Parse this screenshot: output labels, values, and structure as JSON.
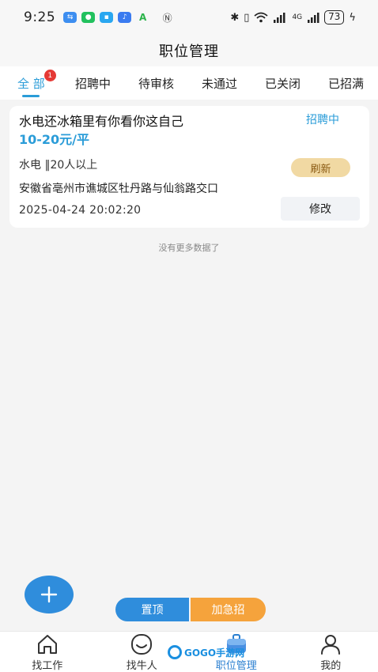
{
  "status_bar": {
    "time": "9:25",
    "battery": "73",
    "network": "4G"
  },
  "header": {
    "title": "职位管理"
  },
  "tabs": [
    {
      "label": "全 部",
      "badge": "1",
      "active": true
    },
    {
      "label": "招聘中"
    },
    {
      "label": "待审核"
    },
    {
      "label": "未通过"
    },
    {
      "label": "已关闭"
    },
    {
      "label": "已招满"
    }
  ],
  "job": {
    "title": "水电还冰箱里有你看你这自己",
    "status": "招聘中",
    "salary": "10-20元/平",
    "meta": "水电 ‖20人以上",
    "address": "安徽省亳州市谯城区牡丹路与仙翁路交口",
    "time": "2025-04-24 20:02:20",
    "refresh_label": "刷新",
    "edit_label": "修改"
  },
  "list_footer": "没有更多数据了",
  "actions": {
    "pin_label": "置顶",
    "urgent_label": "加急招"
  },
  "bottom_nav": [
    {
      "label": "找工作",
      "icon": "house-icon"
    },
    {
      "label": "找牛人",
      "icon": "smile-face-icon"
    },
    {
      "label": "职位管理",
      "icon": "briefcase-icon",
      "active": true
    },
    {
      "label": "我的",
      "icon": "person-icon"
    }
  ],
  "watermark": "GOGO手游网",
  "colors": {
    "accent": "#2a9cd8",
    "fab": "#2f8ddc",
    "urgent": "#f5a33c",
    "refresh_bg": "#f1d9a3",
    "badge": "#e53935"
  }
}
